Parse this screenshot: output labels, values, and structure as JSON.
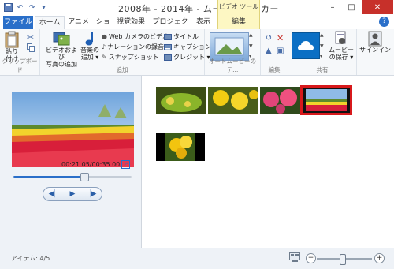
{
  "window": {
    "title": "2008年 - 2014年 - ムービー メーカー",
    "context_tab_group": "ビデオ ツール",
    "minimize": "–",
    "maximize": "□",
    "close": "✕"
  },
  "tabs": [
    {
      "label": "ファイル"
    },
    {
      "label": "ホーム"
    },
    {
      "label": "アニメーション"
    },
    {
      "label": "視覚効果"
    },
    {
      "label": "プロジェクト"
    },
    {
      "label": "表示"
    },
    {
      "label": "編集"
    }
  ],
  "help": "?",
  "ribbon": {
    "clipboard": {
      "paste_line1": "貼り",
      "paste_line2": "付け",
      "group_label": "クリップボード"
    },
    "add": {
      "add_videos_line1": "ビデオおよび",
      "add_videos_line2": "写真の追加",
      "add_music_line1": "音楽の",
      "add_music_line2": "追加 ▾",
      "webcam": "Web カメラのビデオ",
      "narration": "ナレーションの録音 ▾",
      "snapshot": "スナップショット",
      "title": "タイトル",
      "caption": "キャプション",
      "credits": "クレジット ▾",
      "group_label": "追加"
    },
    "automovie": {
      "group_label": "オートムービーのテ..."
    },
    "editing": {
      "group_label": "編集"
    },
    "share": {
      "save_line1": "ムービー",
      "save_line2": "の保存 ▾",
      "group_label": "共有"
    },
    "signin": {
      "label": "サインイン"
    }
  },
  "player": {
    "time": "00:21.05/00:35.00",
    "progress": 0.6
  },
  "storyboard": {
    "clips": [
      "clip-1",
      "clip-2",
      "clip-3",
      "clip-4",
      "clip-5"
    ],
    "selected_index": 3
  },
  "status": {
    "items": "アイテム: 4/5",
    "zoom_level": 0.45,
    "zoom_out": "−",
    "zoom_in": "+"
  },
  "colors": {
    "file_tab": "#2a6fc9",
    "context_tab": "#fdf7c3",
    "selection": "#d7191c",
    "close_button": "#c7302a"
  }
}
